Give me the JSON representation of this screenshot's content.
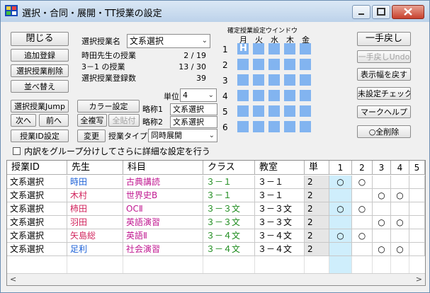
{
  "window": {
    "title": "選択・合同・展開・TT授業の設定"
  },
  "buttons": {
    "close": "閉じる",
    "add": "追加登録",
    "delete_selected": "選択授業削除",
    "sort": "並べ替え",
    "jump": "選択授業Jump",
    "next": "次へ",
    "prev": "前へ",
    "id_setting": "授業ID設定",
    "color_setting": "カラー設定",
    "copy_all": "全複写",
    "paste_all": "全貼付",
    "change": "変更",
    "undo": "一手戻し",
    "undo_undo": "一手戻しUndo",
    "restore_width": "表示幅を戻す",
    "unset_check": "未設定チェック",
    "mark_help": "マークヘルプ",
    "delete_all": "○全削除"
  },
  "info": {
    "selected_lesson_label": "選択授業名",
    "selected_lesson_value": "文系選択",
    "teacher_label": "時田先生の授業",
    "teacher_value": "2 / 19",
    "class_label": "3－1 の授業",
    "class_value": "13 / 30",
    "count_label": "選択授業登録数",
    "count_value": "39",
    "unit_label": "単位",
    "unit_value": "4",
    "abbr1_label": "略称1",
    "abbr1_value": "文系選択",
    "abbr2_label": "略称2",
    "abbr2_value": "文系選択",
    "type_label": "授業タイプ",
    "type_value": "同時展開"
  },
  "grid": {
    "title": "確定授業設定ウインドウ",
    "days": [
      "月",
      "火",
      "水",
      "木",
      "金"
    ],
    "periods": [
      "1",
      "2",
      "3",
      "4",
      "5",
      "6"
    ],
    "mark": "H"
  },
  "checkbox_label": "内訳をグループ分けしてさらに詳細な設定を行う",
  "table": {
    "headers": [
      "授業ID",
      "先生",
      "科目",
      "クラス",
      "教室",
      "単",
      "1",
      "2",
      "3",
      "4",
      "5"
    ],
    "rows": [
      {
        "id": "文系選択",
        "teacher": "時田",
        "subject": "古典講読",
        "klass": "３－１",
        "room": "３－１",
        "unit": "2",
        "marks": [
          "○",
          "○",
          "",
          "",
          ""
        ]
      },
      {
        "id": "文系選択",
        "teacher": "木村",
        "subject": "世界史B",
        "klass": "３－１",
        "room": "３－１",
        "unit": "2",
        "marks": [
          "",
          "",
          "○",
          "○",
          ""
        ]
      },
      {
        "id": "文系選択",
        "teacher": "柿田",
        "subject": "OCⅡ",
        "klass": "３－３文",
        "room": "３－３文",
        "unit": "2",
        "marks": [
          "○",
          "○",
          "",
          "",
          ""
        ]
      },
      {
        "id": "文系選択",
        "teacher": "羽田",
        "subject": "英語演習",
        "klass": "３－３文",
        "room": "３－３文",
        "unit": "2",
        "marks": [
          "",
          "",
          "○",
          "○",
          ""
        ]
      },
      {
        "id": "文系選択",
        "teacher": "矢島総",
        "subject": "英語Ⅱ",
        "klass": "３－４文",
        "room": "３－４文",
        "unit": "2",
        "marks": [
          "○",
          "○",
          "",
          "",
          ""
        ]
      },
      {
        "id": "文系選択",
        "teacher": "足利",
        "subject": "社会演習",
        "klass": "３－４文",
        "room": "３－４文",
        "unit": "2",
        "marks": [
          "",
          "",
          "○",
          "○",
          ""
        ]
      }
    ]
  },
  "colors": {
    "teacher_blue": "#1a5fd6",
    "teacher_red": "#d0205a",
    "subject_magenta": "#c01890",
    "class_green": "#1a8a1a",
    "grid_cell": "#82b4f0",
    "highlight_col": "#cfeefc"
  }
}
